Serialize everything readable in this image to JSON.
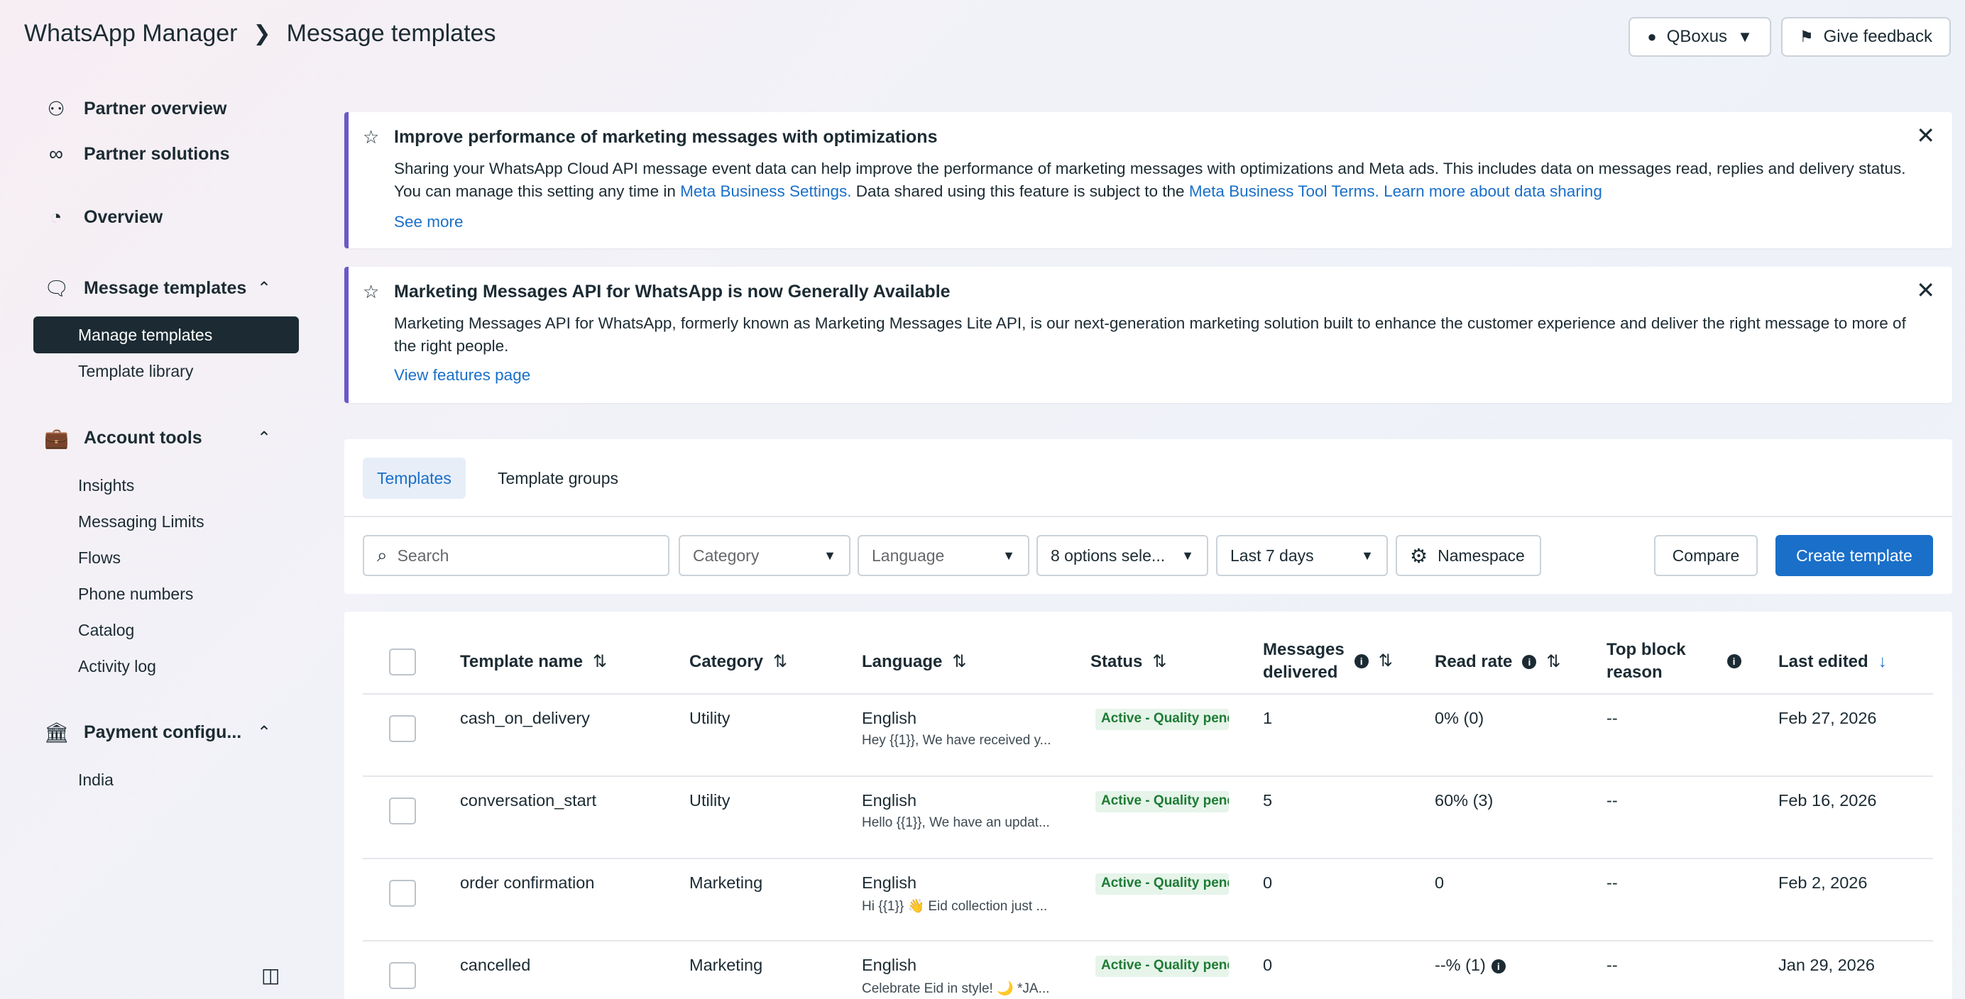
{
  "header": {
    "app_title": "WhatsApp Manager",
    "separator": ">",
    "page_title": "Message templates",
    "account_label": "QBoxus",
    "feedback_label": "Give feedback"
  },
  "sidebar": {
    "partner_overview": "Partner overview",
    "partner_solutions": "Partner solutions",
    "overview": "Overview",
    "message_templates": "Message templates",
    "manage_templates": "Manage templates",
    "template_library": "Template library",
    "account_tools": "Account tools",
    "insights": "Insights",
    "messaging_limits": "Messaging Limits",
    "flows": "Flows",
    "phone_numbers": "Phone numbers",
    "catalog": "Catalog",
    "activity_log": "Activity log",
    "payment_config": "Payment configu...",
    "india": "India"
  },
  "banner1": {
    "title": "Improve performance of marketing messages with optimizations",
    "body_1": "Sharing your WhatsApp Cloud API message event data can help improve the performance of marketing messages with optimizations and Meta ads. This includes data on messages read, replies and delivery status. You can manage this setting any time in ",
    "link_1": "Meta Business Settings.",
    "body_2": " Data shared using this feature is subject to the ",
    "link_2": "Meta Business Tool Terms.",
    "link_3": " Learn more about data sharing",
    "see_more": "See more"
  },
  "banner2": {
    "title": "Marketing Messages API for WhatsApp is now Generally Available",
    "body": "Marketing Messages API for WhatsApp, formerly known as Marketing Messages Lite API, is our next-generation marketing solution built to enhance the customer experience and deliver the right message to more of the right people.",
    "link": "View features page"
  },
  "tabs": {
    "templates": "Templates",
    "template_groups": "Template groups"
  },
  "filters": {
    "search_placeholder": "Search",
    "category": "Category",
    "language": "Language",
    "status_options": "8 options sele...",
    "date_range": "Last 7 days",
    "namespace": "Namespace",
    "compare": "Compare",
    "create": "Create template"
  },
  "table": {
    "columns": {
      "name": "Template name",
      "category": "Category",
      "language": "Language",
      "status": "Status",
      "delivered_1": "Messages",
      "delivered_2": "delivered",
      "read_rate": "Read rate",
      "block_1": "Top block",
      "block_2": "reason",
      "last_edited": "Last edited"
    },
    "rows": [
      {
        "name": "cash_on_delivery",
        "category": "Utility",
        "language": "English",
        "preview": "Hey {{1}}, We have received y...",
        "status": "Active - Quality pending",
        "delivered": "1",
        "read_rate": "0% (0)",
        "block": "--",
        "edited": "Feb 27, 2026"
      },
      {
        "name": "conversation_start",
        "category": "Utility",
        "language": "English",
        "preview": "Hello {{1}}, We have an updat...",
        "status": "Active - Quality pending",
        "delivered": "5",
        "read_rate": "60% (3)",
        "block": "--",
        "edited": "Feb 16, 2026"
      },
      {
        "name": "order confirmation",
        "category": "Marketing",
        "language": "English",
        "preview": "Hi {{1}} 👋 Eid collection just ...",
        "status": "Active - Quality pending",
        "delivered": "0",
        "read_rate": "0",
        "block": "--",
        "edited": "Feb 2, 2026"
      },
      {
        "name": "cancelled",
        "category": "Marketing",
        "language": "English",
        "preview": "Celebrate Eid in style! 🌙 *JA...",
        "status": "Active - Quality pending",
        "delivered": "0",
        "read_rate": "--% (1)",
        "block": "--",
        "edited": "Jan 29, 2026"
      }
    ]
  }
}
